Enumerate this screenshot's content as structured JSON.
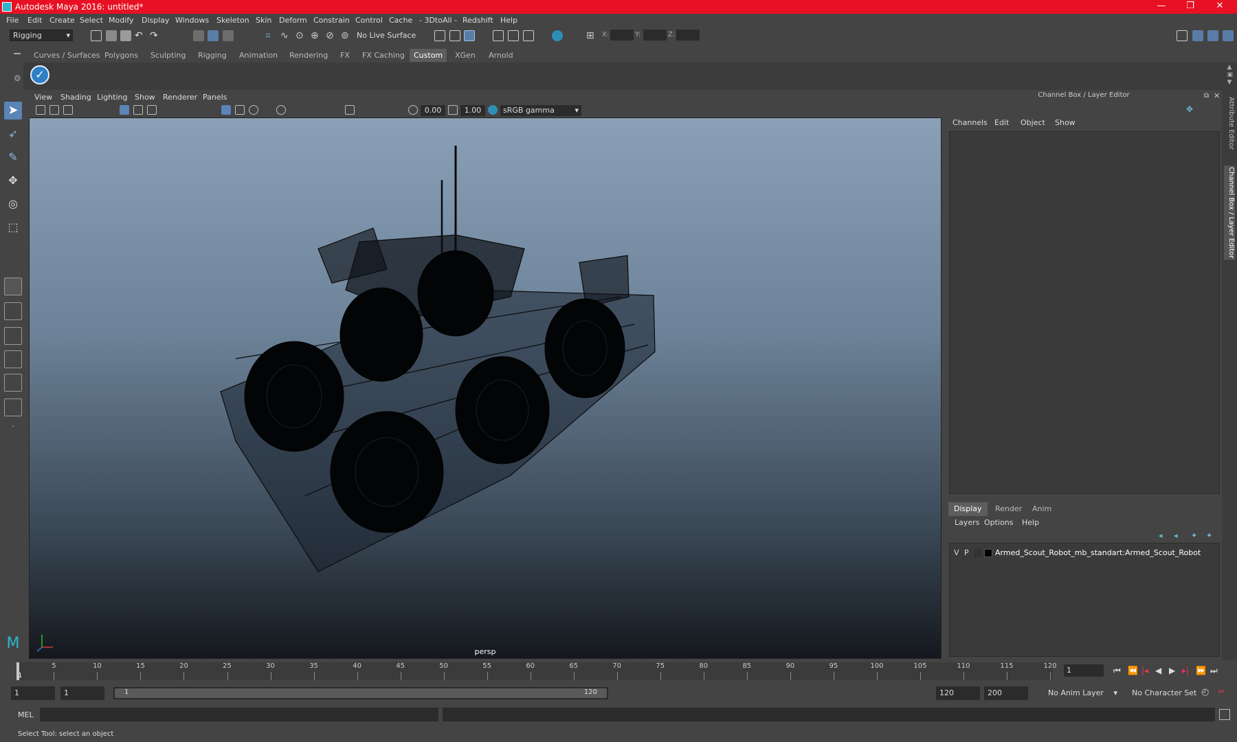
{
  "window": {
    "title": "Autodesk Maya 2016: untitled*",
    "buttons": [
      "—",
      "❐",
      "✕"
    ]
  },
  "menubar": [
    "File",
    "Edit",
    "Create",
    "Select",
    "Modify",
    "Display",
    "Windows",
    "Skeleton",
    "Skin",
    "Deform",
    "Constrain",
    "Control",
    "Cache",
    "- 3DtoAll -",
    "Redshift",
    "Help"
  ],
  "statusline": {
    "menuset": "Rigging",
    "live_surface": "No Live Surface",
    "x_label": "X:",
    "y_label": "Y:",
    "z_label": "Z:"
  },
  "shelf": {
    "tabs": [
      "Curves / Surfaces",
      "Polygons",
      "Sculpting",
      "Rigging",
      "Animation",
      "Rendering",
      "FX",
      "FX Caching",
      "Custom",
      "XGen",
      "Arnold"
    ],
    "active_tab": "Custom"
  },
  "viewport": {
    "menu": [
      "View",
      "Shading",
      "Lighting",
      "Show",
      "Renderer",
      "Panels"
    ],
    "exposure": "0.00",
    "gamma": "1.00",
    "color_space": "sRGB gamma",
    "camera": "persp"
  },
  "channel_box": {
    "title": "Channel Box / Layer Editor",
    "menu": [
      "Channels",
      "Edit",
      "Object",
      "Show"
    ]
  },
  "layer_editor": {
    "tabs": [
      "Display",
      "Render",
      "Anim"
    ],
    "active_tab": "Display",
    "menu": [
      "Layers",
      "Options",
      "Help"
    ],
    "layers": [
      {
        "v": "V",
        "p": "P",
        "name": "Armed_Scout_Robot_mb_standart:Armed_Scout_Robot"
      }
    ]
  },
  "side_tabs": [
    "Attribute Editor",
    "Channel Box / Layer Editor"
  ],
  "timeline": {
    "ticks": [
      5,
      10,
      15,
      20,
      25,
      30,
      35,
      40,
      45,
      50,
      55,
      60,
      65,
      70,
      75,
      80,
      85,
      90,
      95,
      100,
      105,
      110,
      115,
      120
    ],
    "start": 1,
    "end": 120,
    "current_frame": "1",
    "current_marker": "1"
  },
  "range": {
    "start": "1",
    "playback_start": "1",
    "range_start_label": "1",
    "range_end_label": "120",
    "playback_end": "120",
    "end": "200",
    "anim_layer": "No Anim Layer",
    "character_set": "No Character Set"
  },
  "command_line": {
    "label": "MEL"
  },
  "help_line": "Select Tool: select an object"
}
